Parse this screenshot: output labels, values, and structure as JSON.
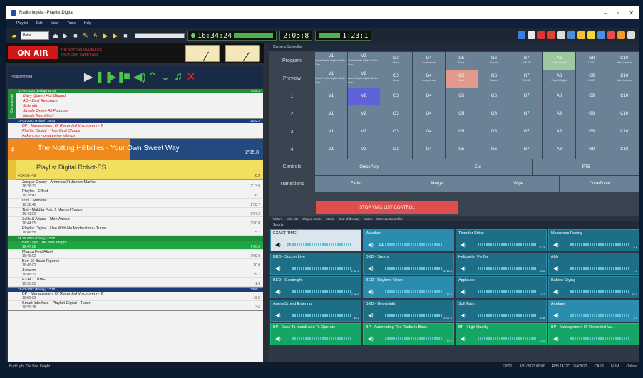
{
  "window": {
    "title": "Radio Inglés - Playlist Digital"
  },
  "menu": [
    "Playlist",
    "Edit",
    "View",
    "Tools",
    "Help"
  ],
  "toolbar": {
    "playlist_value": "Peter",
    "clock": "16:34:24",
    "lcd2": "2:05:8",
    "lcd3": "1:23:1"
  },
  "onair": {
    "label": "ON AIR",
    "line1": "THE NOTTING HILLBILLIES",
    "line2": "YOUR OWN SWEET WAY"
  },
  "programming": {
    "title": "Programming"
  },
  "blocks": [
    {
      "header": "31-03-2023 (Friday) 16:34",
      "total": "0:49.3",
      "side": "Commercial",
      "color": "#1f8f3a",
      "items": [
        "Dairy Queen Hot Glazed",
        "AD - Best Resource",
        "Splenda",
        "Simple Green All Purpose",
        "Mazda Feel Alive!"
      ]
    },
    {
      "header": "31-03-2023 (Friday) 16:43",
      "total": "2002:5",
      "side": "",
      "color": "#1a3b7a",
      "items": [
        "BP - Management Of Recorded Voiceovers - 2",
        "Playlist Digital - Your Best Choice",
        "Ackerman - peacewise silence"
      ]
    }
  ],
  "nowplaying": {
    "side": "AIR",
    "title": "The Notting Hillbillies - Your Own Sweet Way",
    "time": "2'05.8"
  },
  "next": {
    "title": "Playlist Digital Robot-ES",
    "time_start": "4:34:26 PM",
    "value": "6.9"
  },
  "musical": [
    {
      "title": "Jacque Cousy - Amnesia Ft James Mantis",
      "time": "16:36:31",
      "dur": "2'13.9"
    },
    {
      "title": "Playlist - Effect",
      "time": "16:38:41",
      "dur": "6.1"
    },
    {
      "title": "Inxs - Mediate",
      "time": "16:38:48",
      "dur": "2'20.7"
    },
    {
      "title": "Tini - Maldita Foto ft Manuel Turizo",
      "time": "16:41:02",
      "dur": "3'07.3"
    },
    {
      "title": "Zollo & Aitana - Mon Amour",
      "time": "16:44:05",
      "dur": "2'50.8"
    },
    {
      "title": "Playlist Digital - Use With No Moderation - Tuner",
      "time": "16:46:58",
      "dur": "5.7"
    }
  ],
  "block3": {
    "header": "31-03-2023 (Friday) 17:00",
    "total": "",
    "side": "Commercial",
    "items": [
      {
        "title": "Bud Light The Bud Knight",
        "time": "16:47:02",
        "dur": "1'00.0"
      },
      {
        "title": "Mazda Feel Alive!",
        "time": "16:49:02",
        "dur": "1'00.0"
      },
      {
        "title": "Ben 10 Basic Figures",
        "time": "16:49:02",
        "dur": "30.0"
      },
      {
        "title": "Aviseno",
        "time": "16:49:32",
        "dur": "29.7"
      },
      {
        "title": "EXACT TIME",
        "time": "16:50:01",
        "dur": "1.4"
      }
    ]
  },
  "block4": {
    "header": "31-03-2023 (Friday) 17:10",
    "total": "3390:1",
    "items": [
      {
        "title": "BP - Management Of Recorded Voiceovers - 2",
        "time": "16:50:03",
        "dur": "16.5"
      },
      {
        "title": "Smart Interface - Playlist Digital - Tuner",
        "time": "16:50:18",
        "dur": "3.6"
      }
    ]
  },
  "status": {
    "left": "Bud Light The Bud Knight",
    "r1": "13821",
    "r2": "3/31/2023 09:00",
    "r3": "R83 1471D 12/4/2023",
    "r4": "CAPS",
    "r5": "NUM",
    "r6": "Online"
  },
  "camera": {
    "title": "Camera Controller",
    "program": [
      {
        "a": "V1",
        "b": "Voice Playlist Digital Studio Cam"
      },
      {
        "a": "V2",
        "b": "Voice Playlist Digital Studio Cam"
      },
      {
        "a": "G3",
        "b": "Music"
      },
      {
        "a": "G4",
        "b": "Commercial"
      },
      {
        "a": "G5",
        "b": "News"
      },
      {
        "a": "G6",
        "b": "Soccer"
      },
      {
        "a": "G7",
        "b": "DOLAR"
      },
      {
        "a": "A8",
        "b": "Playlist Digital"
      },
      {
        "a": "G9",
        "b": "LOGO"
      },
      {
        "a": "C10",
        "b": "Main Camera"
      }
    ],
    "preview": [
      {
        "a": "V1",
        "b": "Voice Playlist Digital Studio Cam"
      },
      {
        "a": "V2",
        "b": "Voice Playlist Digital Studio Cam"
      },
      {
        "a": "G3",
        "b": "Music"
      },
      {
        "a": "G4",
        "b": "Commercial"
      },
      {
        "a": "G5",
        "b": "News"
      },
      {
        "a": "G6",
        "b": "Soccer"
      },
      {
        "a": "G7",
        "b": "DOLAR"
      },
      {
        "a": "A8",
        "b": "Playlist Digital"
      },
      {
        "a": "G9",
        "b": "LOGO"
      },
      {
        "a": "C10",
        "b": "Main Camera"
      }
    ],
    "cells": [
      "V1",
      "V2",
      "G3",
      "G4",
      "G5",
      "G6",
      "G7",
      "A8",
      "G9",
      "C10"
    ],
    "rowlabels": [
      "Program",
      "Preview",
      "1",
      "2",
      "3",
      "4",
      "Controls",
      "Transitions"
    ],
    "controls": [
      "QuickPlay",
      "Cut",
      "FTB"
    ],
    "transitions": [
      "Fade",
      "Merge",
      "Wipe",
      "CubeZoom"
    ],
    "stop": "STOP VMIX LIST CONTROL",
    "tabs": [
      "Folders",
      "Mini site",
      "Played music",
      "Music",
      "Tool of the day",
      "Notes",
      "Camera Controller"
    ]
  },
  "sports": {
    "title": "Sports",
    "buttons": [
      {
        "t": "EXACT TIME",
        "k": "F3",
        "d": "",
        "cls": "light"
      },
      {
        "t": "Weather",
        "k": "F4",
        "d": "",
        "cls": "mid"
      },
      {
        "t": "Thunder Strike",
        "k": "",
        "d": "10.3",
        "cls": ""
      },
      {
        "t": "Motocross Racing",
        "k": "",
        "d": "5.6",
        "cls": ""
      },
      {
        "t": "BED - Soccer Live",
        "k": "",
        "d": "3' 12.7",
        "cls": ""
      },
      {
        "t": "BED - Sports",
        "k": "",
        "d": "3' 13.4",
        "cls": ""
      },
      {
        "t": "Helicopter Fly By",
        "k": "",
        "d": "12.5",
        "cls": ""
      },
      {
        "t": "Ahh",
        "k": "",
        "d": "1.9",
        "cls": ""
      },
      {
        "t": "BED - Goodnight",
        "k": "",
        "d": "1' 00.0",
        "cls": ""
      },
      {
        "t": "BED - Daytime News",
        "k": "",
        "d": "16.5",
        "cls": "mid"
      },
      {
        "t": "Applause",
        "k": "",
        "d": "4.7",
        "cls": ""
      },
      {
        "t": "Babies Crying",
        "k": "",
        "d": "15.0",
        "cls": ""
      },
      {
        "t": "Arena Crowd Entering",
        "k": "",
        "d": "45.2",
        "cls": ""
      },
      {
        "t": "BED - Goodnight",
        "k": "",
        "d": "2' 07.0",
        "cls": ""
      },
      {
        "t": "Soft Rain",
        "k": "",
        "d": "15.8",
        "cls": ""
      },
      {
        "t": "Airplane",
        "k": "",
        "d": "2.3",
        "cls": "mid"
      },
      {
        "t": "BP - Easy To Install And To Operate",
        "k": "",
        "d": "",
        "cls": "green"
      },
      {
        "t": "BP - Automating The Radio Is Boss",
        "k": "",
        "d": "17.2",
        "cls": "green"
      },
      {
        "t": "BP - High Quality",
        "k": "",
        "d": "14.9",
        "cls": "green"
      },
      {
        "t": "BP - Management Of Recorded Vo...",
        "k": "",
        "d": "",
        "cls": "green"
      }
    ]
  }
}
